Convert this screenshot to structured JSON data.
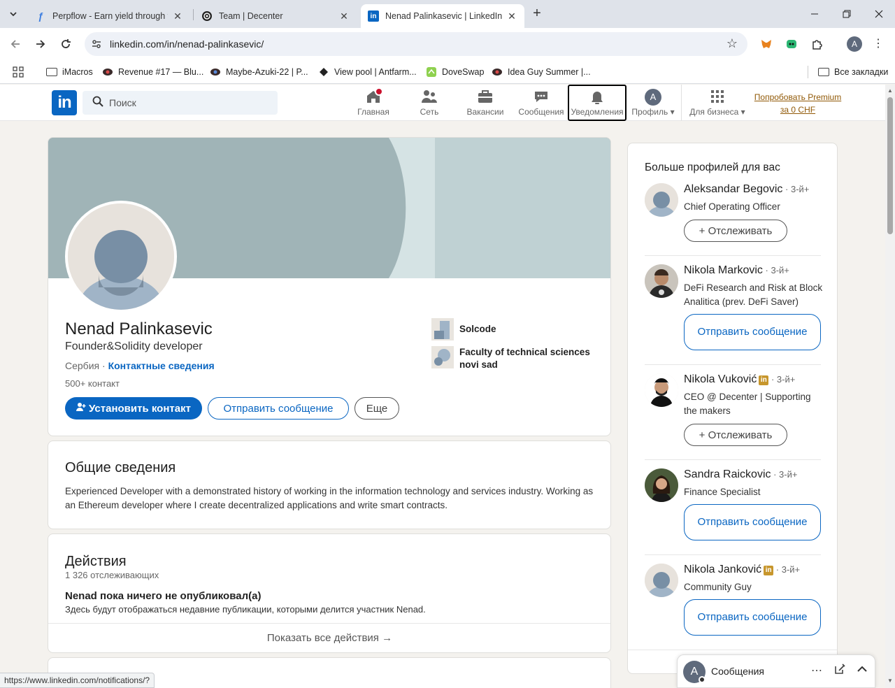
{
  "browser": {
    "tabs": [
      {
        "title": "Perpflow - Earn yield through fu",
        "active": false
      },
      {
        "title": "Team | Decenter",
        "active": false
      },
      {
        "title": "Nenad Palinkasevic | LinkedIn",
        "active": true
      }
    ],
    "url": "linkedin.com/in/nenad-palinkasevic/",
    "profile_initial": "A",
    "bookmarks": [
      "iMacros",
      "Revenue #17 — Blu...",
      "Maybe-Azuki-22 | P...",
      "View pool | Antfarm...",
      "DoveSwap",
      "Idea Guy Summer |..."
    ],
    "all_bookmarks": "Все закладки",
    "status_url": "https://www.linkedin.com/notifications/?"
  },
  "linkedin_nav": {
    "logo": "in",
    "search_placeholder": "Поиск",
    "items": [
      {
        "label": "Главная",
        "icon": "home-icon"
      },
      {
        "label": "Сеть",
        "icon": "network-icon"
      },
      {
        "label": "Вакансии",
        "icon": "briefcase-icon"
      },
      {
        "label": "Сообщения",
        "icon": "chat-icon"
      },
      {
        "label": "Уведомления",
        "icon": "bell-icon"
      },
      {
        "label": "Профиль",
        "icon": "avatar-icon"
      },
      {
        "label": "Для бизнеса",
        "icon": "grid-icon"
      }
    ],
    "me_initial": "A",
    "premium_line1": "Попробовать Premium",
    "premium_line2": "за 0 CHF"
  },
  "profile": {
    "name": "Nenad Palinkasevic",
    "headline": "Founder&Solidity developer",
    "location": "Сербия",
    "contact_link": "Контактные сведения",
    "connections": "500+ контакт",
    "btn_connect": "Установить контакт",
    "btn_message": "Отправить сообщение",
    "btn_more": "Еще",
    "orgs": [
      "Solcode",
      "Faculty of technical sciences novi sad"
    ]
  },
  "about": {
    "title": "Общие сведения",
    "text": "Experienced Developer with a demonstrated history of working in the information technology and services industry. Working as an Ethereum developer where I create decentralized applications and write smart contracts."
  },
  "activity": {
    "title": "Действия",
    "followers": "1 326 отслеживающих",
    "empty_title": "Nenad пока ничего не опубликовал(а)",
    "empty_text": "Здесь будут отображаться недавние публикации, которыми делится участник Nenad.",
    "show_all": "Показать все действия →"
  },
  "sidebar": {
    "title": "Больше профилей для вас",
    "people": [
      {
        "name": "Aleksandar Begovic",
        "degree": " · 3-й+",
        "headline": "Chief Operating Officer",
        "action": "+ Отслеживать"
      },
      {
        "name": "Nikola Markovic",
        "degree": " · 3-й+",
        "headline": "DeFi Research and Risk at Block Analitica (prev. DeFi Saver)",
        "action": "Отправить сообщение"
      },
      {
        "name": "Nikola Vuković",
        "degree": " · 3-й+",
        "headline": "CEO @ Decenter | Supporting the makers",
        "action": "+ Отслеживать"
      },
      {
        "name": "Sandra Raickovic",
        "degree": " · 3-й+",
        "headline": "Finance Specialist",
        "action": "Отправить сообщение"
      },
      {
        "name": "Nikola Janković",
        "degree": " · 3-й+",
        "headline": "Community Guy",
        "action": "Отправить сообщение"
      }
    ]
  },
  "messaging": {
    "label": "Сообщения",
    "initial": "A"
  },
  "colors": {
    "linkedin_blue": "#0a66c2",
    "premium": "#915907",
    "notification_red": "#cb112d"
  }
}
